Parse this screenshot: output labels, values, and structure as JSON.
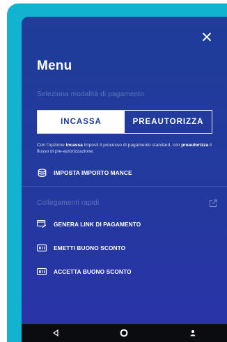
{
  "menu": {
    "title": "Menu",
    "payment_mode_label": "Seleziona modalità di pagamento",
    "modes": [
      {
        "label": "INCASSA",
        "active": true
      },
      {
        "label": "PREAUTORIZZA",
        "active": false
      }
    ],
    "description": {
      "p1": "Con l'opzione ",
      "b1": "incassa",
      "p2": " imposti il processo di pagamento standard, con ",
      "b2": "preautorizza",
      "p3": " il flusso di pre-autorizzazione."
    },
    "tip_item": {
      "label": "IMPOSTA IMPORTO MANCE",
      "icon": "coins-icon"
    },
    "quick_links_label": "Collegamenti rapidi",
    "quick_links": [
      {
        "label": "GENERA LINK DI PAGAMENTO",
        "icon": "payment-link-icon"
      },
      {
        "label": "EMETTI BUONO SCONTO",
        "icon": "voucher-icon"
      },
      {
        "label": "ACCETTA BUONO SCONTO",
        "icon": "voucher-icon"
      }
    ]
  },
  "colors": {
    "frame": "#11b3d1",
    "panel": "#24399f",
    "accent_text": "#1f3d99",
    "navbar": "#0b0c10"
  }
}
